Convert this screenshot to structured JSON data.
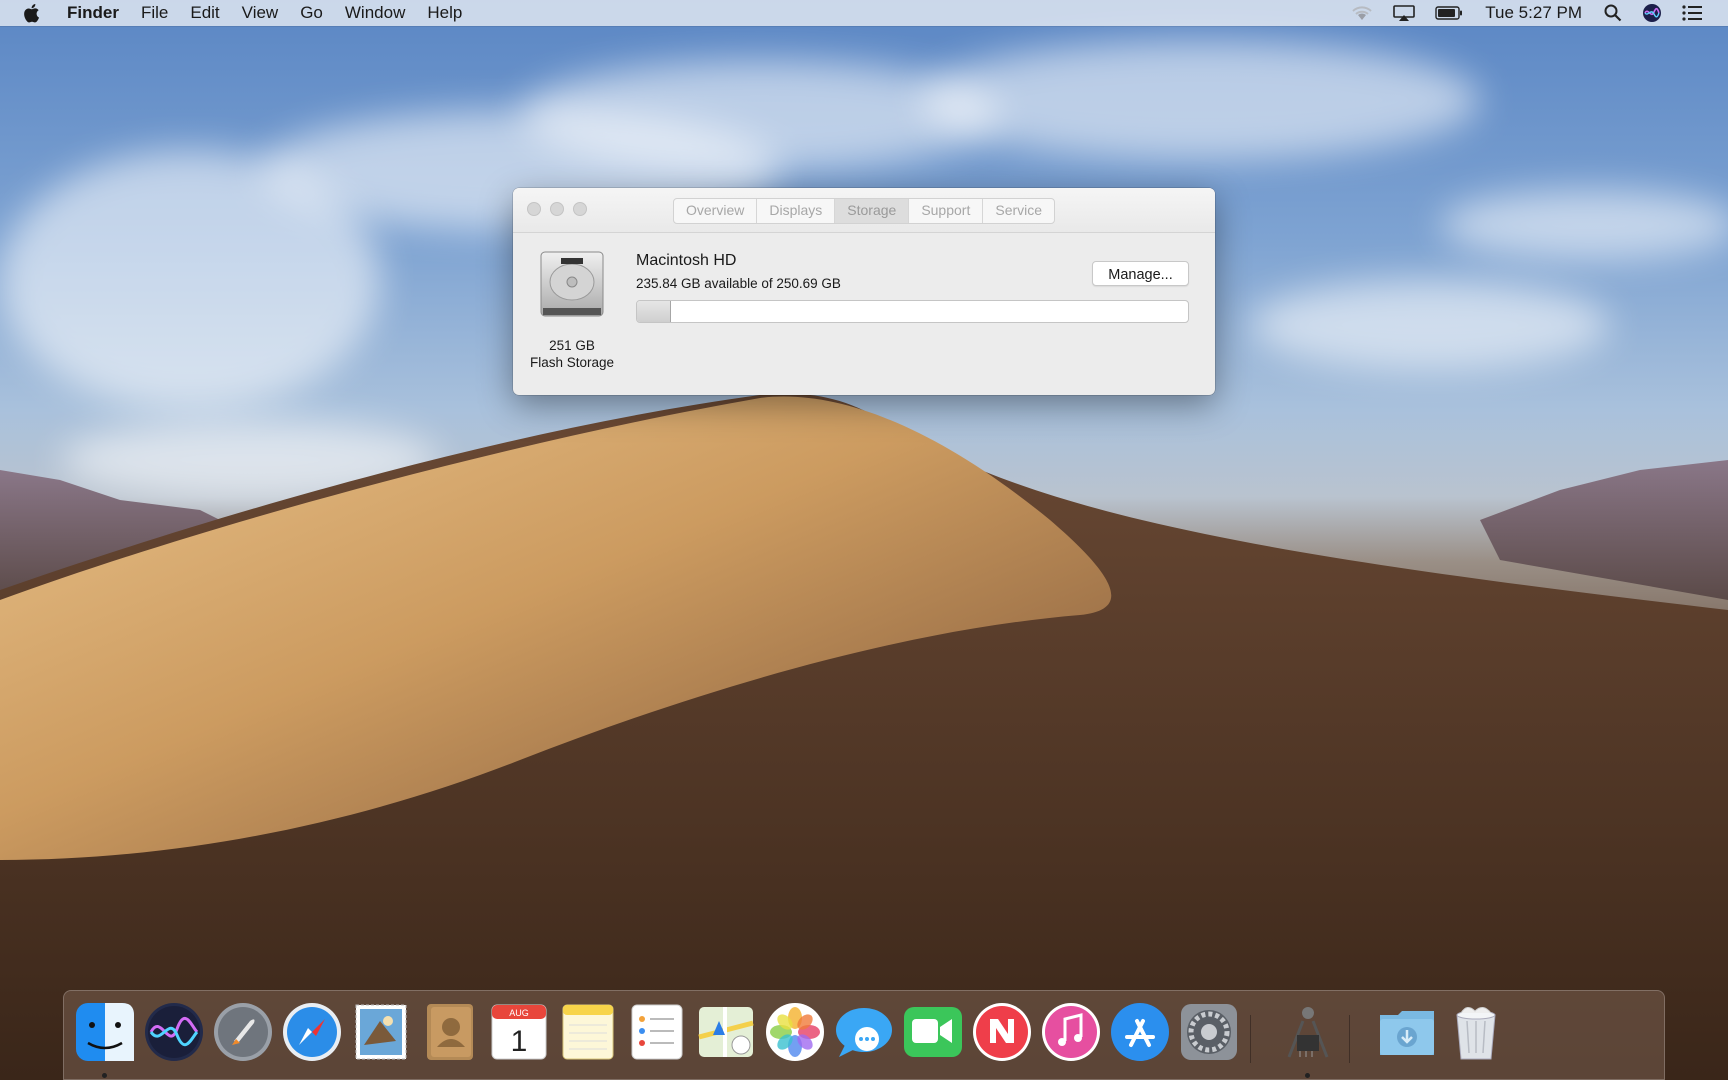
{
  "menubar": {
    "apple_icon": "apple-logo-icon",
    "app_name": "Finder",
    "menus": [
      "File",
      "Edit",
      "View",
      "Go",
      "Window",
      "Help"
    ],
    "status_icons": [
      "wifi-icon",
      "airplay-icon",
      "battery-icon"
    ],
    "clock": "Tue 5:27 PM",
    "right_icons": [
      "spotlight-search-icon",
      "siri-icon",
      "notification-center-icon"
    ]
  },
  "about_window": {
    "tabs": [
      {
        "label": "Overview",
        "active": false
      },
      {
        "label": "Displays",
        "active": false
      },
      {
        "label": "Storage",
        "active": true
      },
      {
        "label": "Support",
        "active": false
      },
      {
        "label": "Service",
        "active": false
      }
    ],
    "disk_icon": "hard-drive-icon",
    "disk_capacity": "251 GB",
    "disk_type": "Flash Storage",
    "volume_name": "Macintosh HD",
    "volume_available": "235.84 GB available of 250.69 GB",
    "manage_label": "Manage...",
    "used_fraction": 0.059
  },
  "dock": {
    "apps": [
      {
        "name": "Finder",
        "icon": "finder-icon",
        "running": true
      },
      {
        "name": "Siri",
        "icon": "siri-icon",
        "running": false
      },
      {
        "name": "Launchpad",
        "icon": "launchpad-rocket-icon",
        "running": false
      },
      {
        "name": "Safari",
        "icon": "safari-compass-icon",
        "running": false
      },
      {
        "name": "Mail",
        "icon": "mail-stamp-icon",
        "running": false
      },
      {
        "name": "Contacts",
        "icon": "contacts-book-icon",
        "running": false
      },
      {
        "name": "Calendar",
        "icon": "calendar-icon",
        "running": false,
        "month": "AUG",
        "day": "1"
      },
      {
        "name": "Notes",
        "icon": "notes-icon",
        "running": false
      },
      {
        "name": "Reminders",
        "icon": "reminders-icon",
        "running": false
      },
      {
        "name": "Maps",
        "icon": "maps-icon",
        "running": false
      },
      {
        "name": "Photos",
        "icon": "photos-icon",
        "running": false
      },
      {
        "name": "Messages",
        "icon": "messages-icon",
        "running": false
      },
      {
        "name": "FaceTime",
        "icon": "facetime-icon",
        "running": false
      },
      {
        "name": "News",
        "icon": "news-icon",
        "running": false
      },
      {
        "name": "iTunes",
        "icon": "itunes-music-icon",
        "running": false
      },
      {
        "name": "App Store",
        "icon": "app-store-icon",
        "running": false
      },
      {
        "name": "System Preferences",
        "icon": "system-preferences-gear-icon",
        "running": false
      },
      {
        "name": "System Information",
        "icon": "system-information-icon",
        "running": true
      },
      {
        "name": "Downloads",
        "icon": "downloads-folder-icon",
        "running": false
      },
      {
        "name": "Trash",
        "icon": "trash-icon",
        "running": false
      }
    ]
  }
}
